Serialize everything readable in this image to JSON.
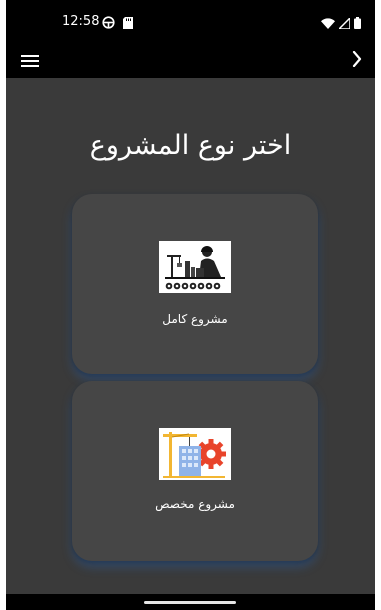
{
  "status_bar": {
    "time": "12:58",
    "left_icons": [
      "steering-wheel-icon",
      "sd-card-icon"
    ],
    "right_icons": [
      "wifi-icon",
      "signal-icon",
      "battery-icon"
    ]
  },
  "app_bar": {
    "menu_icon": "hamburger-menu-icon",
    "next_icon": "chevron-right-icon"
  },
  "main": {
    "title": "اختر نوع المشروع",
    "cards": [
      {
        "label": "مشروع كامل",
        "icon": "full-project-illustration"
      },
      {
        "label": "مشروع مخصص",
        "icon": "custom-project-illustration"
      }
    ]
  },
  "colors": {
    "background": "#000000",
    "content": "#3a3a3a",
    "card": "#464646",
    "card_glow": "#286ec8",
    "text": "#ffffff"
  }
}
